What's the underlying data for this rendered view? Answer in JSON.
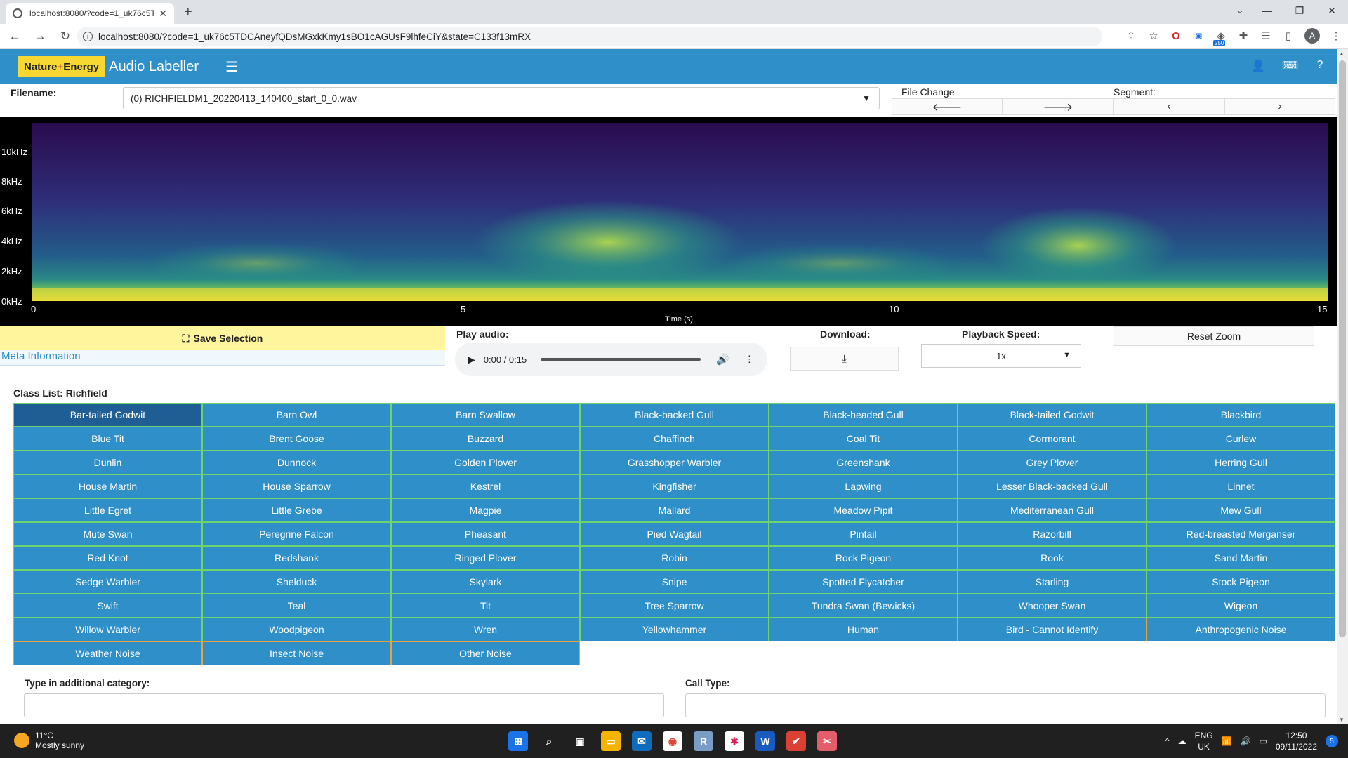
{
  "browser": {
    "tab_title": "localhost:8080/?code=1_uk76c5T",
    "url": "localhost:8080/?code=1_uk76c5TDCAneyfQDsMGxkKmy1sBO1cAGUsF9lhfeCiY&state=C133f13mRX",
    "ext_badge": "250",
    "profile_initial": "A"
  },
  "app": {
    "logo_nature": "Nature",
    "logo_plus": "+",
    "logo_energy": "Energy",
    "title": "Audio Labeller"
  },
  "file": {
    "label": "Filename:",
    "selected": "(0) RICHFIELDM1_20220413_140400_start_0_0.wav",
    "file_change_label": "File Change",
    "segment_label": "Segment:"
  },
  "spectrogram": {
    "y_ticks": [
      "10kHz",
      "8kHz",
      "6kHz",
      "4kHz",
      "2kHz",
      "0kHz"
    ],
    "x_ticks": [
      "0",
      "5",
      "10",
      "15"
    ],
    "x_label": "Time (s)",
    "colors": {
      "low": "#2b0b4f",
      "mid": "#2a7f8e",
      "high": "#f7e33a"
    }
  },
  "controls": {
    "save_selection": "Save Selection",
    "meta_information": "Meta Information",
    "play_audio_label": "Play audio:",
    "audio_time": "0:00 / 0:15",
    "download_label": "Download:",
    "playback_speed_label": "Playback Speed:",
    "playback_speed_value": "1x",
    "reset_zoom": "Reset Zoom"
  },
  "class_list": {
    "title": "Class List: Richfield",
    "items": [
      "Bar-tailed Godwit",
      "Barn Owl",
      "Barn Swallow",
      "Black-backed Gull",
      "Black-headed Gull",
      "Black-tailed Godwit",
      "Blackbird",
      "Blue Tit",
      "Brent Goose",
      "Buzzard",
      "Chaffinch",
      "Coal Tit",
      "Cormorant",
      "Curlew",
      "Dunlin",
      "Dunnock",
      "Golden Plover",
      "Grasshopper Warbler",
      "Greenshank",
      "Grey Plover",
      "Herring Gull",
      "House Martin",
      "House Sparrow",
      "Kestrel",
      "Kingfisher",
      "Lapwing",
      "Lesser Black-backed Gull",
      "Linnet",
      "Little Egret",
      "Little Grebe",
      "Magpie",
      "Mallard",
      "Meadow Pipit",
      "Mediterranean Gull",
      "Mew Gull",
      "Mute Swan",
      "Peregrine Falcon",
      "Pheasant",
      "Pied Wagtail",
      "Pintail",
      "Razorbill",
      "Red-breasted Merganser",
      "Red Knot",
      "Redshank",
      "Ringed Plover",
      "Robin",
      "Rock Pigeon",
      "Rook",
      "Sand Martin",
      "Sedge Warbler",
      "Shelduck",
      "Skylark",
      "Snipe",
      "Spotted Flycatcher",
      "Starling",
      "Stock Pigeon",
      "Swift",
      "Teal",
      "Tit",
      "Tree Sparrow",
      "Tundra Swan (Bewicks)",
      "Whooper Swan",
      "Wigeon",
      "Willow Warbler",
      "Woodpigeon",
      "Wren",
      "Yellowhammer",
      "Human",
      "Bird - Cannot Identify",
      "Anthropogenic Noise",
      "Weather Noise",
      "Insect Noise",
      "Other Noise"
    ],
    "selected_index": 0,
    "selected_color": "#1f5e94",
    "bird_border_color": "#6fd36f",
    "other_border_color": "#e8a33a",
    "first_other_index": 67
  },
  "inputs": {
    "additional_label": "Type in additional category:",
    "call_type_label": "Call Type:"
  },
  "taskbar": {
    "temperature": "11°C",
    "weather": "Mostly sunny",
    "lang1": "ENG",
    "lang2": "UK",
    "time": "12:50",
    "date": "09/11/2022",
    "notifications": "5",
    "r_icon": "R",
    "word_icon": "W"
  }
}
